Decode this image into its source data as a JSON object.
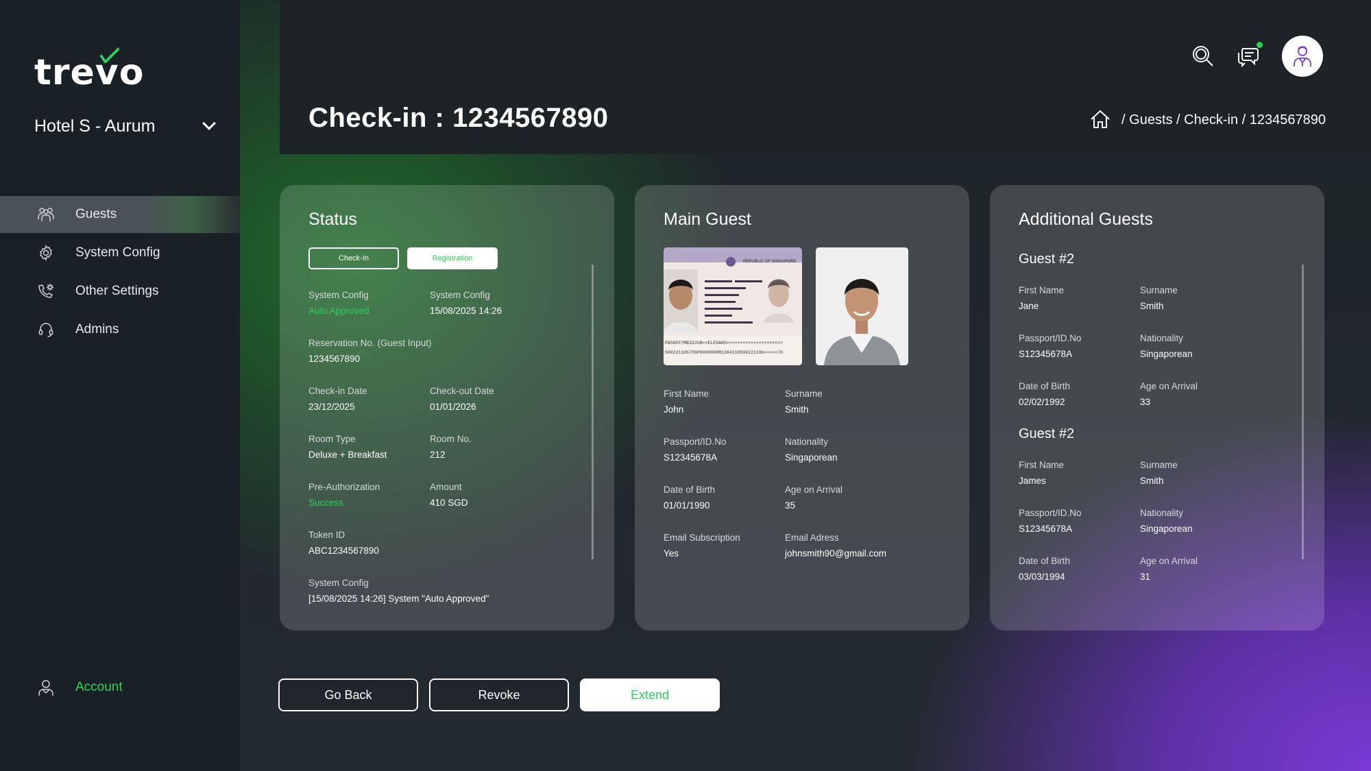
{
  "brand": {
    "logo_text": "trevo",
    "accent": "#2ed15a",
    "purple": "#7a3ad6"
  },
  "sidebar": {
    "hotel": "Hotel S - Aurum",
    "items": [
      {
        "label": "Guests",
        "icon": "guests-icon",
        "active": true
      },
      {
        "label": "System Config",
        "icon": "gear-icon",
        "active": false
      },
      {
        "label": "Other Settings",
        "icon": "settings-icon",
        "active": false
      },
      {
        "label": "Admins",
        "icon": "headset-icon",
        "active": false
      }
    ],
    "account_label": "Account"
  },
  "header": {
    "title": "Check-in : 1234567890",
    "breadcrumb": "/ Guests / Check-in / 1234567890"
  },
  "status": {
    "title": "Status",
    "tab_checkin": "Check-In",
    "tab_registration": "Registration",
    "fields": [
      {
        "label": "System Config",
        "value": "Auto Approved",
        "green": true
      },
      {
        "label": "System Config",
        "value": "15/08/2025  14:26"
      },
      {
        "label": "Reservation No. (Guest Input)",
        "value": "1234567890",
        "full": true
      },
      {
        "label": "Check-in Date",
        "value": "23/12/2025"
      },
      {
        "label": "Check-out Date",
        "value": "01/01/2026"
      },
      {
        "label": "Room Type",
        "value": "Deluxe + Breakfast"
      },
      {
        "label": "Room No.",
        "value": "212"
      },
      {
        "label": "Pre-Authorization",
        "value": "Success",
        "green": true
      },
      {
        "label": "Amount",
        "value": "410 SGD"
      },
      {
        "label": "Token ID",
        "value": "ABC1234567890",
        "full": true
      },
      {
        "label": "System Config",
        "value": "[15/08/2025  14:26] System \"Auto Approved\"",
        "full": true
      }
    ]
  },
  "main_guest": {
    "title": "Main Guest",
    "passport_header": "REPUBLIC OF SINGAPORE",
    "passport_mrz1": "PASGPCYMBIDJUN<<ELEGANS<<<<<<<<<<<<<<<<<<<<<",
    "passport_mrz2": "S0022110b7SGP6808088M1304118S0022110b<<<<<70",
    "fields": [
      {
        "label": "First Name",
        "value": "John"
      },
      {
        "label": "Surname",
        "value": "Smith"
      },
      {
        "label": "Passport/ID.No",
        "value": "S12345678A"
      },
      {
        "label": "Nationality",
        "value": "Singaporean"
      },
      {
        "label": "Date of Birth",
        "value": "01/01/1990"
      },
      {
        "label": "Age on Arrival",
        "value": "35"
      },
      {
        "label": "Email Subscription",
        "value": "Yes"
      },
      {
        "label": "Email Adress",
        "value": "johnsmith90@gmail.com"
      }
    ]
  },
  "additional": {
    "title": "Additional Guests",
    "guests": [
      {
        "heading": "Guest #2",
        "fields": [
          {
            "label": "First Name",
            "value": "Jane"
          },
          {
            "label": "Surname",
            "value": "Smith"
          },
          {
            "label": "Passport/ID.No",
            "value": "S12345678A"
          },
          {
            "label": "Nationality",
            "value": "Singaporean"
          },
          {
            "label": "Date of Birth",
            "value": "02/02/1992"
          },
          {
            "label": "Age on Arrival",
            "value": "33"
          }
        ]
      },
      {
        "heading": "Guest #2",
        "fields": [
          {
            "label": "First Name",
            "value": "James"
          },
          {
            "label": "Surname",
            "value": "Smith"
          },
          {
            "label": "Passport/ID.No",
            "value": "S12345678A"
          },
          {
            "label": "Nationality",
            "value": "Singaporean"
          },
          {
            "label": "Date of Birth",
            "value": "03/03/1994"
          },
          {
            "label": "Age on Arrival",
            "value": "31"
          }
        ]
      }
    ]
  },
  "buttons": {
    "go_back": "Go Back",
    "revoke": "Revoke",
    "extend": "Extend"
  }
}
